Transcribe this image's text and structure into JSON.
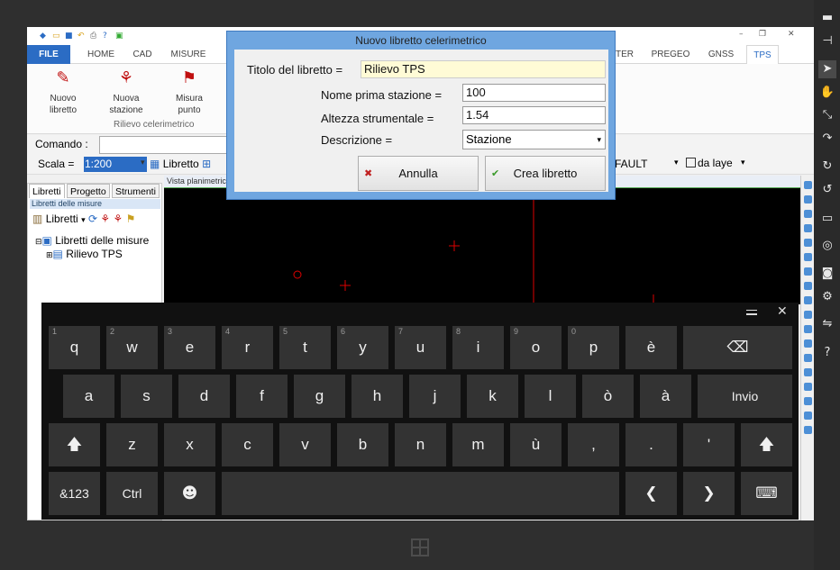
{
  "ribbon": {
    "tabs": [
      "FILE",
      "HOME",
      "CAD",
      "MISURE",
      "TER",
      "PREGEO",
      "GNSS",
      "TPS"
    ],
    "buttons": [
      {
        "label1": "Nuovo",
        "label2": "libretto",
        "icon": "new-book-icon"
      },
      {
        "label1": "Nuova",
        "label2": "stazione",
        "icon": "new-station-icon"
      },
      {
        "label1": "Misura",
        "label2": "punto",
        "icon": "measure-point-icon"
      }
    ],
    "group_label": "Rilievo celerimetrico"
  },
  "command": {
    "label": "Comando :"
  },
  "scale": {
    "label": "Scala =",
    "value": "1:200",
    "libretto": "Libretto",
    "fault": "FAULT",
    "da_layer": "da laye"
  },
  "left_panel": {
    "tabs": [
      "Libretti",
      "Progetto",
      "Strumenti"
    ],
    "header": "Libretti delle misure",
    "toolbar_label": "Libretti",
    "tree_root": "Libretti delle misure",
    "tree_child": "Rilievo TPS"
  },
  "view": {
    "title": "Vista planimetric"
  },
  "dialog": {
    "title": "Nuovo libretto celerimetrico",
    "titolo_label": "Titolo del libretto =",
    "titolo_value": "Rilievo TPS",
    "stazione_label": "Nome prima stazione =",
    "stazione_value": "100",
    "altezza_label": "Altezza strumentale =",
    "altezza_value": "1.54",
    "descrizione_label": "Descrizione =",
    "descrizione_value": "Stazione",
    "cancel_label": "Annulla",
    "create_label": "Crea libretto"
  },
  "keyboard": {
    "row1": [
      {
        "k": "q",
        "n": "1"
      },
      {
        "k": "w",
        "n": "2"
      },
      {
        "k": "e",
        "n": "3"
      },
      {
        "k": "r",
        "n": "4"
      },
      {
        "k": "t",
        "n": "5"
      },
      {
        "k": "y",
        "n": "6"
      },
      {
        "k": "u",
        "n": "7"
      },
      {
        "k": "i",
        "n": "8"
      },
      {
        "k": "o",
        "n": "9"
      },
      {
        "k": "p",
        "n": "0"
      },
      {
        "k": "è",
        "n": ""
      }
    ],
    "row2": [
      "a",
      "s",
      "d",
      "f",
      "g",
      "h",
      "j",
      "k",
      "l",
      "ò",
      "à"
    ],
    "row3": [
      "z",
      "x",
      "c",
      "v",
      "b",
      "n",
      "m",
      "ù",
      ",",
      ".",
      "'"
    ],
    "invio": "Invio",
    "sym": "&123",
    "ctrl": "Ctrl"
  },
  "colors": {
    "accent": "#2b6cc4",
    "dialog_frame": "#6fa6e0",
    "keyboard_bg": "#111111",
    "key_bg": "#333333"
  }
}
